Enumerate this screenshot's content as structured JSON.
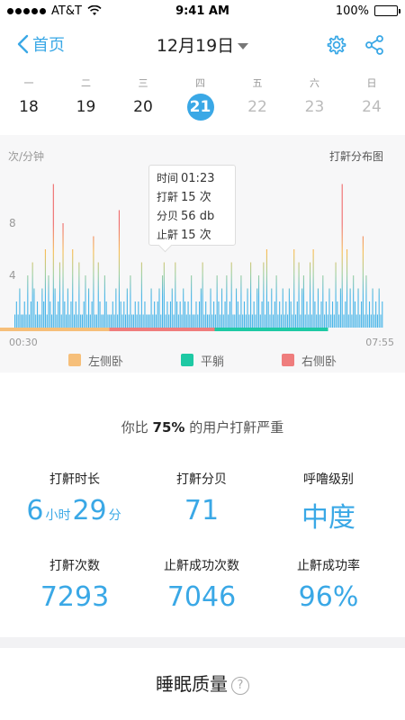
{
  "status_bar": {
    "carrier": "AT&T",
    "time": "9:41 AM",
    "battery": "100%"
  },
  "navbar": {
    "back_label": "首页",
    "title": "12月19日"
  },
  "week": [
    {
      "wk": "一",
      "num": "18",
      "state": "normal"
    },
    {
      "wk": "二",
      "num": "19",
      "state": "normal"
    },
    {
      "wk": "三",
      "num": "20",
      "state": "normal"
    },
    {
      "wk": "四",
      "num": "21",
      "state": "selected"
    },
    {
      "wk": "五",
      "num": "22",
      "state": "future"
    },
    {
      "wk": "六",
      "num": "23",
      "state": "future"
    },
    {
      "wk": "日",
      "num": "24",
      "state": "future"
    }
  ],
  "chart_data": {
    "type": "bar",
    "title": "打鼾分布图",
    "ylabel": "次/分钟",
    "yticks": [
      "4",
      "8"
    ],
    "ylim": [
      0,
      12
    ],
    "x_start": "00:30",
    "x_end": "07:55",
    "colors": {
      "low": "#49b5e8",
      "mid": "#9fcf9e",
      "high": "#f6bf55",
      "peak": "#ef6c6c"
    },
    "values": [
      1,
      2,
      1,
      3,
      1,
      1,
      2,
      1,
      4,
      1,
      2,
      5,
      3,
      1,
      2,
      1,
      1,
      3,
      2,
      6,
      1,
      4,
      2,
      1,
      11,
      3,
      1,
      2,
      5,
      1,
      8,
      2,
      1,
      3,
      1,
      2,
      6,
      1,
      2,
      1,
      5,
      1,
      1,
      2,
      4,
      1,
      3,
      1,
      2,
      7,
      1,
      1,
      5,
      2,
      1,
      1,
      4,
      2,
      1,
      1,
      1,
      2,
      1,
      3,
      1,
      9,
      2,
      1,
      2,
      1,
      3,
      1,
      4,
      1,
      1,
      2,
      1,
      2,
      1,
      5,
      1,
      2,
      1,
      1,
      1,
      3,
      1,
      2,
      1,
      2,
      3,
      1,
      4,
      5,
      1,
      2,
      1,
      2,
      3,
      1,
      5,
      2,
      1,
      2,
      1,
      3,
      2,
      1,
      2,
      1,
      4,
      1,
      1,
      2,
      1,
      2,
      3,
      5,
      1,
      2,
      1,
      1,
      3,
      1,
      2,
      1,
      4,
      2,
      1,
      3,
      1,
      2,
      4,
      1,
      2,
      5,
      1,
      1,
      3,
      2,
      1,
      4,
      1,
      2,
      1,
      3,
      1,
      5,
      1,
      2,
      1,
      3,
      4,
      1,
      2,
      5,
      1,
      6,
      2,
      1,
      3,
      1,
      2,
      4,
      1,
      2,
      1,
      3,
      1,
      2,
      1,
      3,
      2,
      1,
      6,
      1,
      2,
      5,
      1,
      3,
      4,
      1,
      2,
      1,
      5,
      1,
      6,
      2,
      1,
      3,
      1,
      2,
      4,
      1,
      2,
      1,
      3,
      1,
      2,
      1,
      5,
      2,
      1,
      3,
      11,
      1,
      2,
      6,
      1,
      3,
      1,
      4,
      2,
      1,
      3,
      1,
      2,
      7,
      1,
      4,
      1,
      2,
      1,
      3,
      1,
      2,
      1,
      3,
      1,
      2
    ],
    "position_segments": [
      {
        "name": "左侧卧",
        "from": 0.0,
        "to": 0.27,
        "color": "#f6bf7a"
      },
      {
        "name": "右侧卧",
        "from": 0.27,
        "to": 0.53,
        "color": "#ef7d7d"
      },
      {
        "name": "平躺",
        "from": 0.53,
        "to": 0.81,
        "color": "#1ec9a4"
      }
    ],
    "legend": [
      {
        "name": "左侧卧",
        "color": "#f6bf7a"
      },
      {
        "name": "平躺",
        "color": "#1ec9a4"
      },
      {
        "name": "右侧卧",
        "color": "#ef7d7d"
      }
    ]
  },
  "tooltip": {
    "time_label": "时间",
    "time_value": "01:23",
    "snore_label": "打鼾",
    "snore_value": "15 次",
    "db_label": "分贝",
    "db_value": "56 db",
    "stop_label": "止鼾",
    "stop_value": "15 次"
  },
  "compare": {
    "prefix": "你比",
    "percent": "75%",
    "suffix": "的用户打鼾严重"
  },
  "stats": {
    "duration_label": "打鼾时长",
    "duration_hours": "6",
    "hours_unit": "小时",
    "duration_minutes": "29",
    "minutes_unit": "分",
    "db_label": "打鼾分贝",
    "db_value": "71",
    "level_label": "呼噜级别",
    "level_value": "中度",
    "count_label": "打鼾次数",
    "count_value": "7293",
    "stop_count_label": "止鼾成功次数",
    "stop_count_value": "7046",
    "stop_rate_label": "止鼾成功率",
    "stop_rate_value": "96%"
  },
  "sleep_quality": {
    "title": "睡眠质量",
    "help": "?"
  }
}
